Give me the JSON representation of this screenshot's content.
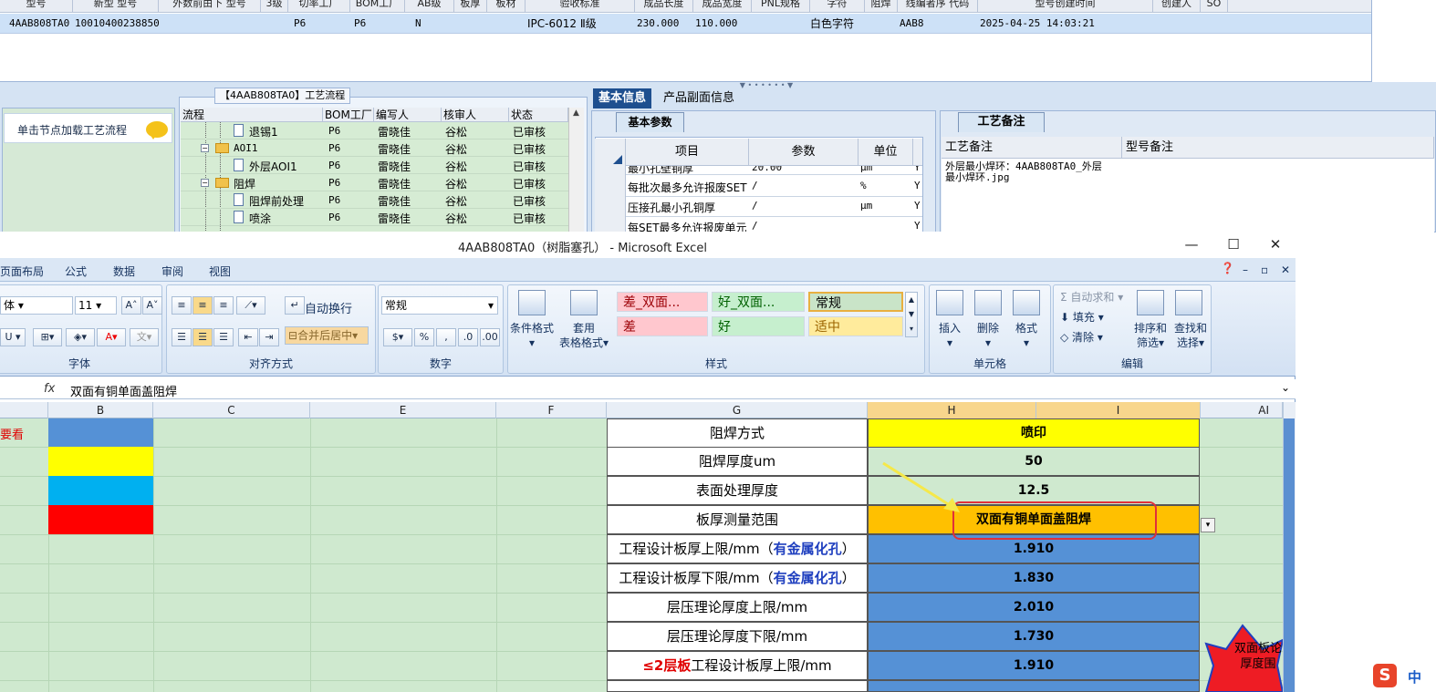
{
  "top_grid": {
    "header_fragments": [
      "型号",
      "新型 型号",
      "外数前由下 型号",
      "3级",
      "切率工厂",
      "BOM工厂",
      "AB级",
      "板厚",
      "板材",
      "验收标准",
      "成品长度",
      "成品宽度",
      "PNL规格",
      "字符",
      "阻焊",
      "线编者序 代码",
      "型号创建时间",
      "创建人",
      "SO"
    ],
    "row": {
      "code": "4AAB808TA0",
      "number": "10010400238850",
      "factory1": "P6",
      "factory2": "P6",
      "flag": "N",
      "standard": "IPC-6012 Ⅱ级",
      "length": "230.000",
      "width": "110.000",
      "char": "白色字符",
      "series": "AAB8",
      "created": "2025-04-25 14:03:21"
    }
  },
  "left_panel": {
    "hint": "单击节点加载工艺流程"
  },
  "process_panel": {
    "title": "【4AAB808TA0】工艺流程",
    "columns": [
      "流程",
      "BOM工厂",
      "编写人",
      "核审人",
      "状态"
    ],
    "rows": [
      {
        "name": "退锡1",
        "bom": "P6",
        "writer": "雷晓佳",
        "reviewer": "谷松",
        "status": "已审核",
        "type": "file",
        "indent": 2
      },
      {
        "name": "AOI1",
        "bom": "P6",
        "writer": "雷晓佳",
        "reviewer": "谷松",
        "status": "已审核",
        "type": "folder",
        "indent": 1
      },
      {
        "name": "外层AOI1",
        "bom": "P6",
        "writer": "雷晓佳",
        "reviewer": "谷松",
        "status": "已审核",
        "type": "file",
        "indent": 2
      },
      {
        "name": "阻焊",
        "bom": "P6",
        "writer": "雷晓佳",
        "reviewer": "谷松",
        "status": "已审核",
        "type": "folder",
        "indent": 1
      },
      {
        "name": "阻焊前处理",
        "bom": "P6",
        "writer": "雷晓佳",
        "reviewer": "谷松",
        "status": "已审核",
        "type": "file",
        "indent": 2
      },
      {
        "name": "喷涂",
        "bom": "P6",
        "writer": "雷晓佳",
        "reviewer": "谷松",
        "status": "已审核",
        "type": "file",
        "indent": 2
      }
    ]
  },
  "info_tabs": {
    "basic": "基本信息",
    "product": "产品副面信息",
    "basic_params_tab": "基本参数",
    "columns": [
      "项目",
      "参数",
      "单位"
    ],
    "rows": [
      {
        "item": "最小孔壁铜厚",
        "value": "20.00",
        "unit": "μm",
        "flag": "Y"
      },
      {
        "item": "每批次最多允许报废SET",
        "value": "/",
        "unit": "%",
        "flag": "Y"
      },
      {
        "item": "压接孔最小孔铜厚",
        "value": "/",
        "unit": "μm",
        "flag": "Y"
      },
      {
        "item": "每SET最多允许报废单元",
        "value": "/",
        "unit": "",
        "flag": "Y"
      }
    ]
  },
  "remarks": {
    "tab": "工艺备注",
    "col1": "工艺备注",
    "col2": "型号备注",
    "text": "外层最小焊环：4AAB808TA0_外层最小焊环.jpg"
  },
  "excel": {
    "title": "4AAB808TA0（树脂塞孔） - Microsoft Excel",
    "win_min": "—",
    "win_max": "☐",
    "win_close": "✕",
    "tabs": [
      "页面布局",
      "公式",
      "数据",
      "审阅",
      "视图"
    ],
    "font_size": "11",
    "wrap_label": "自动换行",
    "merge_label": "合并后居中",
    "number_format": "常规",
    "cond_format": "条件格式",
    "table_format_1": "套用",
    "table_format_2": "表格格式",
    "styles": {
      "bad_dbl": "差_双面...",
      "good_dbl": "好_双面...",
      "normal": "常规",
      "bad": "差",
      "good": "好",
      "neutral": "适中"
    },
    "insert": "插入",
    "delete": "删除",
    "format": "格式",
    "autosum": "自动求和",
    "fill": "填充",
    "clear": "清除",
    "sort_1": "排序和",
    "sort_2": "筛选",
    "find_1": "查找和",
    "find_2": "选择",
    "group_labels": {
      "font": "字体",
      "align": "对齐方式",
      "number": "数字",
      "style": "样式",
      "cells": "单元格",
      "edit": "编辑"
    },
    "fx": "fx",
    "formula": "双面有铜单面盖阻焊",
    "columns": [
      "B",
      "C",
      "E",
      "F",
      "G",
      "H",
      "I",
      "AI"
    ],
    "side_note": "要看",
    "color_blocks": [
      "#5591d6",
      "#ffff00",
      "#00b0f0",
      "#ff0000"
    ],
    "table": [
      {
        "label": "阻焊方式",
        "value": "喷印",
        "fill": "#ffff00"
      },
      {
        "label": "阻焊厚度um",
        "value": "50",
        "fill": "#cfe9cf"
      },
      {
        "label": "表面处理厚度",
        "value": "12.5",
        "fill": "#cfe9cf"
      },
      {
        "label": "板厚测量范围",
        "value": "双面有铜单面盖阻焊",
        "fill": "#ffc000"
      },
      {
        "label": "工程设计板厚上限/mm（",
        "label_em": "有金属化孔",
        "label_tail": "）",
        "value": "1.910",
        "fill": "#5591d6"
      },
      {
        "label": "工程设计板厚下限/mm（",
        "label_em": "有金属化孔",
        "label_tail": "）",
        "value": "1.830",
        "fill": "#5591d6"
      },
      {
        "label": "层压理论厚度上限/mm",
        "value": "2.010",
        "fill": "#5591d6"
      },
      {
        "label": "层压理论厚度下限/mm",
        "value": "1.730",
        "fill": "#5591d6"
      },
      {
        "label_red": "≤2层板",
        "label": "工程设计板厚上限/mm",
        "value": "1.910",
        "fill": "#5591d6"
      }
    ],
    "callout": "双面板论厚度围",
    "ime": "中"
  }
}
